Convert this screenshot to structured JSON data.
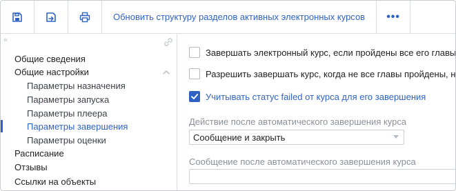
{
  "toolbar": {
    "save_icon": "floppy-save-icon",
    "save_close_icon": "save-close-icon",
    "print_icon": "printer-icon",
    "update_label": "Обновить структуру разделов активных электронных курсов",
    "more_label": "•••",
    "accent_color": "#2f62c7"
  },
  "sidebar": {
    "items": [
      {
        "label": "Общие сведения"
      },
      {
        "label": "Общие настройки"
      },
      {
        "label": "Параметры назначения"
      },
      {
        "label": "Параметры запуска"
      },
      {
        "label": "Параметры плеера"
      },
      {
        "label": "Параметры завершения"
      },
      {
        "label": "Параметры оценки"
      },
      {
        "label": "Расписание"
      },
      {
        "label": "Отзывы"
      },
      {
        "label": "Ссылки на объекты"
      }
    ],
    "active_item": "Параметры завершения"
  },
  "content": {
    "options": [
      {
        "label": "Завершать электронный курс, если пройдены все его главы",
        "checked": false
      },
      {
        "label": "Разрешить завершать курс, когда не все главы пройдены, но",
        "checked": false
      },
      {
        "label": "Учитывать статус failed от курса для его завершения",
        "checked": true
      }
    ],
    "action_label": "Действие после автоматического завершения курса",
    "action_value": "Сообщение и закрыть",
    "message_label": "Сообщение после автоматического завершения курса",
    "message_value": ""
  }
}
